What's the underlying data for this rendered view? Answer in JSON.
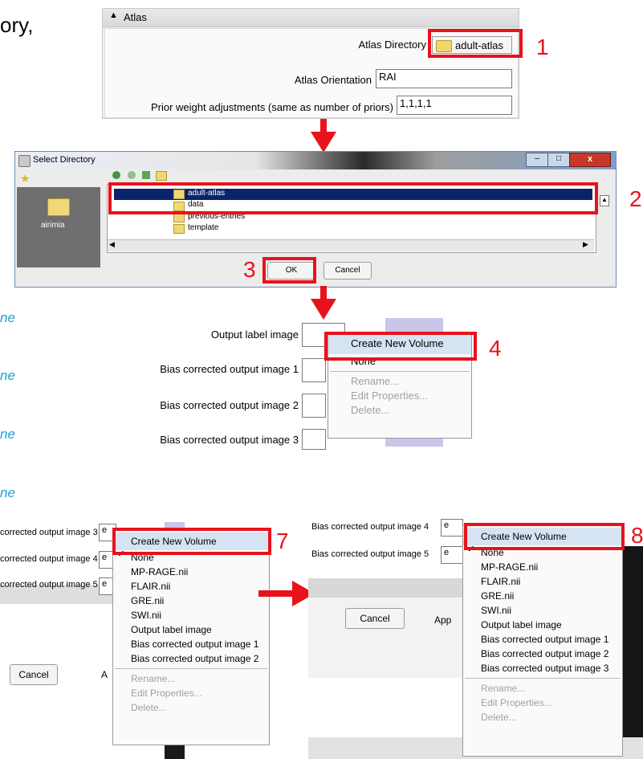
{
  "intro_fragment": "ory,",
  "step_numbers": [
    "1",
    "2",
    "3",
    "4",
    "7",
    "8"
  ],
  "colors": {
    "red": "#e8121b",
    "cyan": "#1ba0d8",
    "highlight": "#0a246a"
  },
  "atlas_panel": {
    "header": "Atlas",
    "directory_label": "Atlas Directory",
    "directory_value": "adult-atlas",
    "orientation_label": "Atlas Orientation",
    "orientation_value": "RAI",
    "prior_label": "Prior weight adjustments (same as number of priors)",
    "prior_value": "1,1,1,1"
  },
  "dialog": {
    "title": "Select Directory",
    "left_place": "airimia",
    "folders": [
      "adult-atlas",
      "data",
      "previous-entries",
      "template"
    ],
    "ok": "OK",
    "cancel": "Cancel"
  },
  "cyan_fragments": [
    "ne",
    "ne",
    "ne",
    "ne"
  ],
  "outputs_panel": {
    "labels": [
      "Output label image",
      "Bias corrected output image 1",
      "Bias corrected output image 2",
      "Bias corrected output image 3"
    ],
    "menu": {
      "create": "Create New Volume",
      "none": "None",
      "rename": "Rename...",
      "edit": "Edit Properties...",
      "delete": "Delete..."
    }
  },
  "panel7": {
    "labels": [
      "corrected output image 3",
      "corrected output image 4",
      "corrected output image 5"
    ],
    "field_char": "e",
    "cancel": "Cancel",
    "apply_fragment": "A",
    "menu": [
      "Create New Volume",
      "None",
      "MP-RAGE.nii",
      "FLAIR.nii",
      "GRE.nii",
      "SWI.nii",
      "Output label image",
      "Bias corrected output image 1",
      "Bias corrected output image 2"
    ],
    "menu_disabled": [
      "Rename...",
      "Edit Properties...",
      "Delete..."
    ]
  },
  "panel8": {
    "labels": [
      "Bias corrected output image 4",
      "Bias corrected output image 5"
    ],
    "field_char": "e",
    "cancel": "Cancel",
    "apply_fragment": "App",
    "menu": [
      "Create New Volume",
      "None",
      "MP-RAGE.nii",
      "FLAIR.nii",
      "GRE.nii",
      "SWI.nii",
      "Output label image",
      "Bias corrected output image 1",
      "Bias corrected output image 2",
      "Bias corrected output image 3"
    ],
    "menu_disabled": [
      "Rename...",
      "Edit Properties...",
      "Delete..."
    ]
  }
}
